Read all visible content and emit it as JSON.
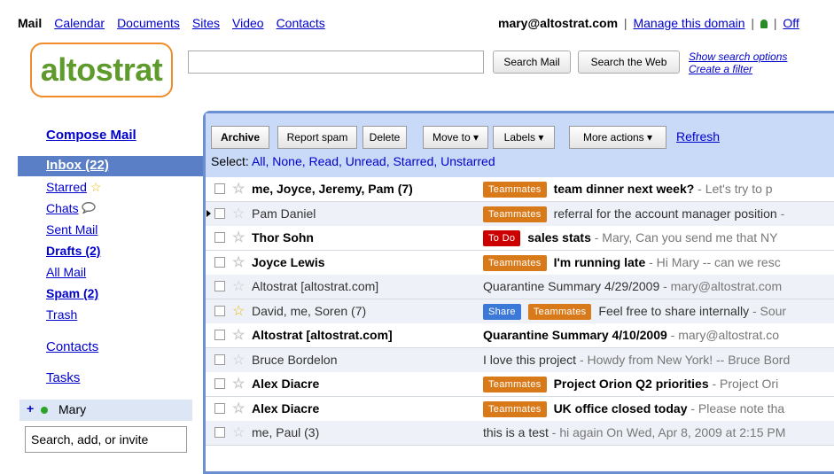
{
  "topnav": {
    "links": [
      "Mail",
      "Calendar",
      "Documents",
      "Sites",
      "Video",
      "Contacts"
    ],
    "email": "mary@altostrat.com",
    "manage": "Manage this domain",
    "sep": "|",
    "offline": "Off"
  },
  "logo": {
    "text": "altostrat"
  },
  "search": {
    "input_value": "",
    "search_mail": "Search Mail",
    "search_web": "Search the Web",
    "show_options": "Show search options",
    "create_filter": "Create a filter"
  },
  "sidebar": {
    "compose": "Compose Mail",
    "inbox": "Inbox (22)",
    "starred": "Starred",
    "chats": "Chats",
    "sent": "Sent Mail",
    "drafts": "Drafts (2)",
    "all": "All Mail",
    "spam": "Spam (2)",
    "trash": "Trash",
    "contacts": "Contacts",
    "tasks": "Tasks",
    "chat_user": "Mary",
    "chat_plus": "+",
    "chat_placeholder": "Search, add, or invite"
  },
  "toolbar": {
    "archive": "Archive",
    "report_spam": "Report spam",
    "delete": "Delete",
    "move_to": "Move to ▾",
    "labels": "Labels ▾",
    "more_actions": "More actions ▾",
    "refresh": "Refresh",
    "select_label": "Select:",
    "select_options": "All, None, Read, Unread, Starred, Unstarred"
  },
  "colors": {
    "teammates": "#d97a1a",
    "todo": "#cc0000",
    "share": "#3c78d8",
    "accent": "#6b8fd1"
  },
  "emails": [
    {
      "sender": "me, Joyce, Jeremy, Pam (7)",
      "tag1": "Teammates",
      "tag2": "",
      "subject": "team dinner next week?",
      "snippet": " - Let's try to p"
    },
    {
      "sender": "Pam Daniel",
      "tag1": "Teammates",
      "tag2": "",
      "subject": "referral for the account manager position",
      "snippet": " -"
    },
    {
      "sender": "Thor Sohn",
      "tag1": "To Do",
      "tag2": "",
      "subject": "sales stats",
      "snippet": " - Mary, Can you send me that NY"
    },
    {
      "sender": "Joyce Lewis",
      "tag1": "Teammates",
      "tag2": "",
      "subject": "I'm running late",
      "snippet": " - Hi Mary -- can we resc"
    },
    {
      "sender": "Altostrat [altostrat.com]",
      "tag1": "",
      "tag2": "",
      "subject": "Quarantine Summary 4/29/2009",
      "snippet": " - mary@altostrat.com"
    },
    {
      "sender": "David, me, Soren (7)",
      "tag1": "Share",
      "tag2": "Teammates",
      "subject": "Feel free to share internally",
      "snippet": " - Sour"
    },
    {
      "sender": "Altostrat [altostrat.com]",
      "tag1": "",
      "tag2": "",
      "subject": "Quarantine Summary 4/10/2009",
      "snippet": " - mary@altostrat.co"
    },
    {
      "sender": "Bruce Bordelon",
      "tag1": "",
      "tag2": "",
      "subject": "I love this project",
      "snippet": " - Howdy from New York! -- Bruce Bord"
    },
    {
      "sender": "Alex Diacre",
      "tag1": "Teammates",
      "tag2": "",
      "subject": "Project Orion Q2 priorities",
      "snippet": " - Project Ori"
    },
    {
      "sender": "Alex Diacre",
      "tag1": "Teammates",
      "tag2": "",
      "subject": "UK office closed today",
      "snippet": " - Please note tha"
    },
    {
      "sender": "me, Paul (3)",
      "tag1": "",
      "tag2": "",
      "subject": "this is a test",
      "snippet": " - hi again On Wed, Apr 8, 2009 at 2:15 PM"
    }
  ]
}
